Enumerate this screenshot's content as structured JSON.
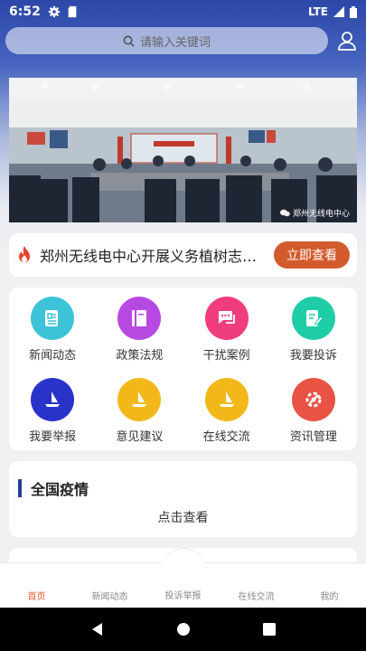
{
  "status_bar": {
    "time": "6:52",
    "network": "LTE"
  },
  "search": {
    "placeholder": "请输入关键词"
  },
  "banner": {
    "caption": "郑州无线电中心"
  },
  "news": {
    "headline": "郑州无线电中心开展义务植树志愿...",
    "button_label": "立即查看"
  },
  "grid": {
    "items": [
      {
        "label": "新闻动态",
        "color": "#3cc3d7",
        "icon": "news-icon"
      },
      {
        "label": "政策法规",
        "color": "#b748e2",
        "icon": "book-icon"
      },
      {
        "label": "干扰案例",
        "color": "#ef3d7e",
        "icon": "chat-icon"
      },
      {
        "label": "我要投诉",
        "color": "#1ecda5",
        "icon": "edit-icon"
      },
      {
        "label": "我要举报",
        "color": "#2a33c9",
        "icon": "report-icon"
      },
      {
        "label": "意见建议",
        "color": "#f2b81a",
        "icon": "suggest-icon"
      },
      {
        "label": "在线交流",
        "color": "#f2b81a",
        "icon": "exchange-icon"
      },
      {
        "label": "资讯管理",
        "color": "#e85343",
        "icon": "manage-icon"
      }
    ]
  },
  "covid": {
    "title": "全国疫情",
    "view_label": "点击查看"
  },
  "bottom_nav": {
    "home": "首页",
    "news": "新闻动态",
    "complaint": "投诉举报",
    "exchange": "在线交流",
    "mine": "我的"
  },
  "colors": {
    "accent": "#d35a2d",
    "header": "#2c47a8"
  }
}
